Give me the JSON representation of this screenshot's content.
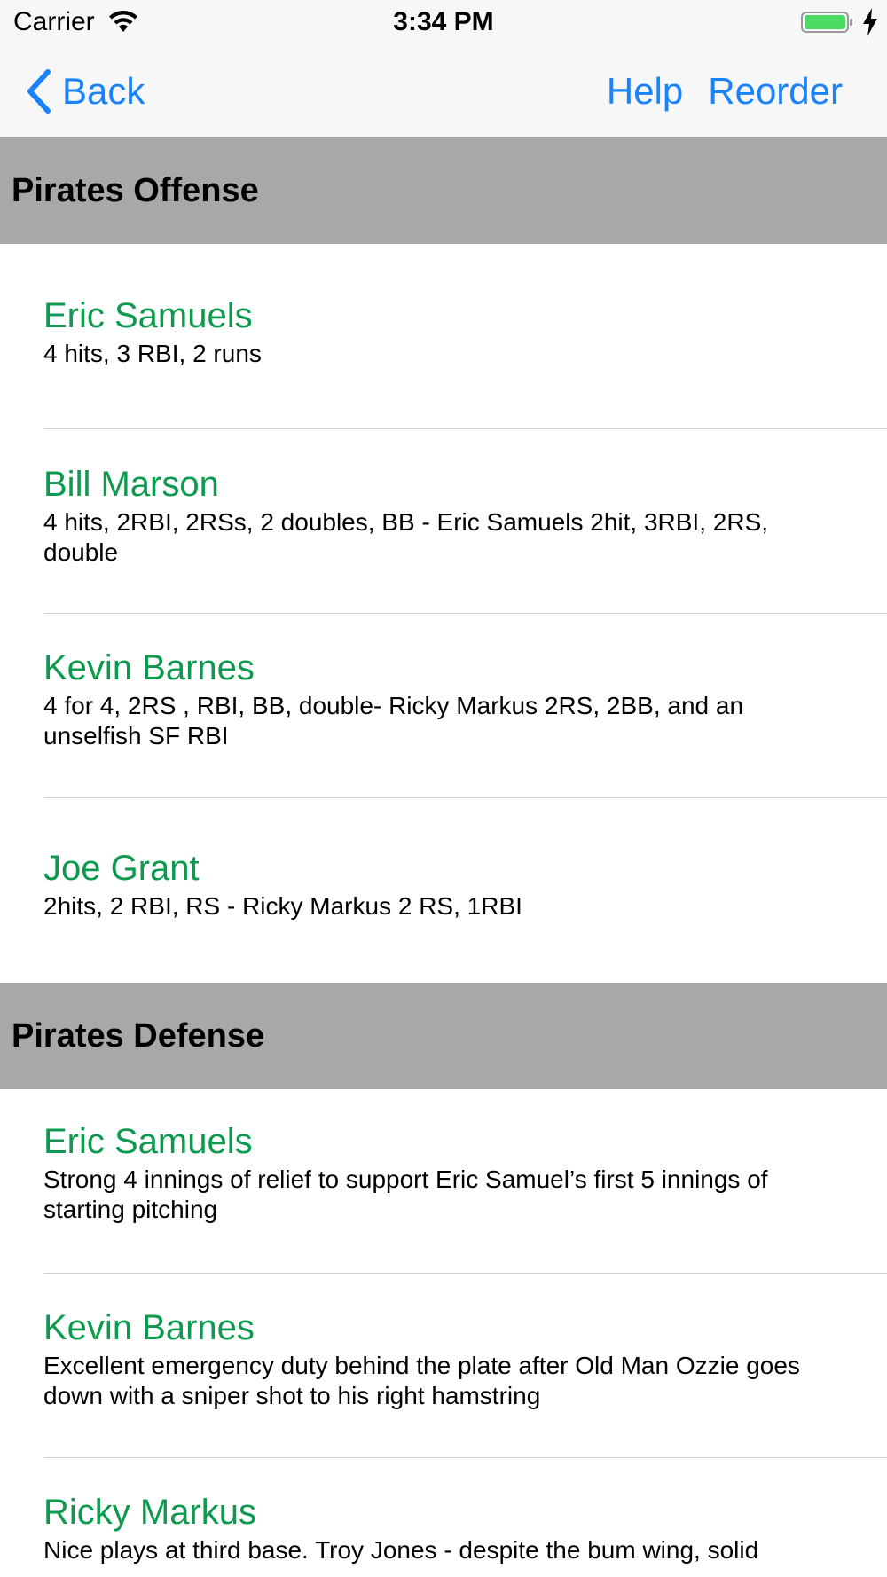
{
  "status_bar": {
    "carrier": "Carrier",
    "time": "3:34 PM",
    "battery_color": "#4cd964"
  },
  "nav": {
    "back_label": "Back",
    "help_label": "Help",
    "reorder_label": "Reorder",
    "tint_color": "#1a82fb"
  },
  "colors": {
    "player_name": "#0e9a4e",
    "section_header_bg": "#a8a8a8"
  },
  "sections": [
    {
      "title": "Pirates Offense",
      "rows": [
        {
          "name": "Eric Samuels",
          "detail": "4 hits, 3 RBI, 2 runs"
        },
        {
          "name": "Bill Marson",
          "detail": "4 hits, 2RBI, 2RSs, 2 doubles, BB - Eric Samuels 2hit, 3RBI, 2RS, double"
        },
        {
          "name": "Kevin Barnes",
          "detail": "4 for 4, 2RS , RBI, BB, double-  Ricky Markus 2RS, 2BB, and an unselfish SF RBI"
        },
        {
          "name": "Joe Grant",
          "detail": "2hits, 2 RBI, RS - Ricky Markus 2 RS, 1RBI"
        }
      ]
    },
    {
      "title": "Pirates Defense",
      "rows": [
        {
          "name": "Eric Samuels",
          "detail": "Strong 4 innings of relief to support Eric Samuel’s first 5 innings of starting pitching"
        },
        {
          "name": "Kevin Barnes",
          "detail": "Excellent emergency duty behind the plate after Old Man Ozzie goes down with a sniper shot to his right hamstring"
        },
        {
          "name": "Ricky Markus",
          "detail": "Nice plays at third base.  Troy Jones - despite the bum wing, solid"
        }
      ]
    }
  ]
}
